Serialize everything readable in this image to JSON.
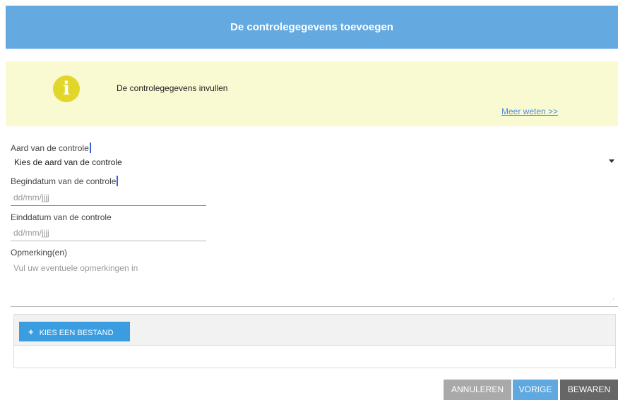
{
  "header": {
    "title": "De controlegegevens toevoegen"
  },
  "info": {
    "icon": "info-icon",
    "icon_glyph": "i",
    "text": "De controlegegevens invullen",
    "link": "Meer weten >>"
  },
  "form": {
    "type": {
      "label": "Aard van de controle",
      "selected": "Kies de aard van de controle"
    },
    "start_date": {
      "label": "Begindatum van de controle",
      "placeholder": "dd/mm/jjjj"
    },
    "end_date": {
      "label": "Einddatum van de controle",
      "placeholder": "dd/mm/jjjj"
    },
    "remarks": {
      "label": "Opmerking(en)",
      "placeholder": "Vul uw eventuele opmerkingen in"
    },
    "upload": {
      "icon": "plus-icon",
      "plus_glyph": "+",
      "label": "KIES EEN BESTAND"
    }
  },
  "actions": {
    "cancel": "ANNULEREN",
    "previous": "VORIGE",
    "save": "BEWAREN"
  },
  "colors": {
    "header": "#64a9e0",
    "info_bg": "#fafad2",
    "info_icon": "#e3d62b",
    "upload_button": "#3a9de0",
    "cancel": "#a9a9a9",
    "previous": "#5fa8e0",
    "save": "#666666"
  }
}
